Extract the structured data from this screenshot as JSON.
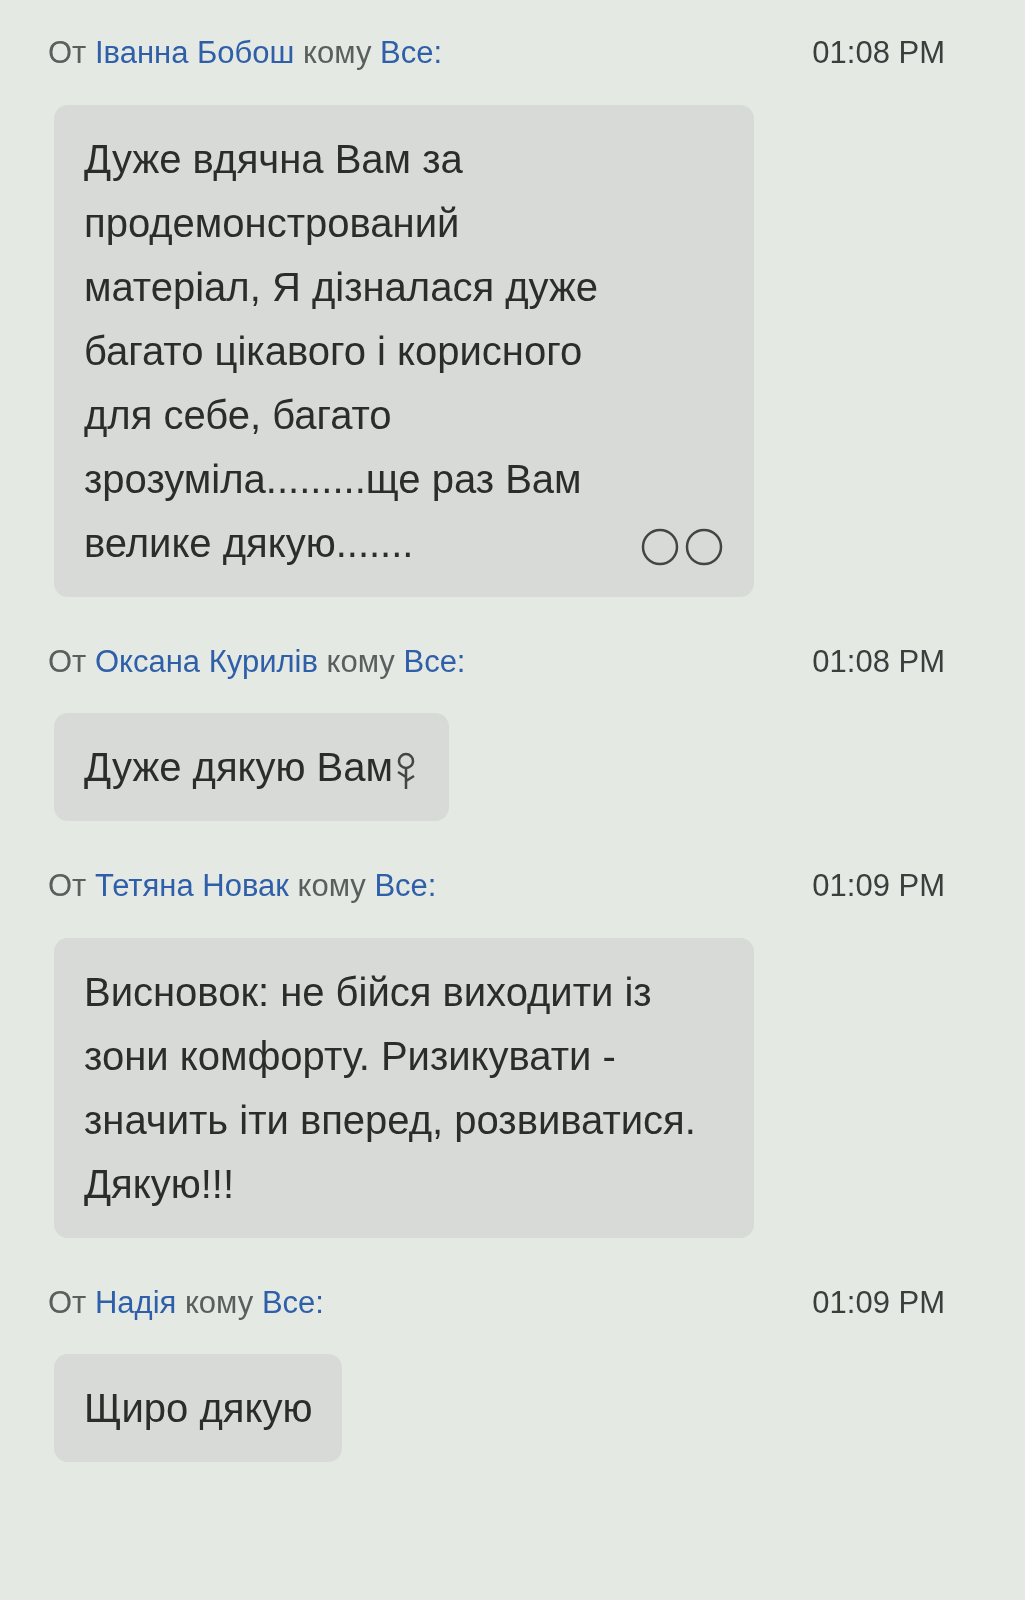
{
  "messages": [
    {
      "from_label": "От",
      "sender": "Іванна Бобош",
      "to_label": "кому",
      "recipient": "Все:",
      "time": "01:08 PM",
      "text": "Дуже вдячна Вам за продемонстрований матеріал, Я дізналася дуже багато цікавого і корисного для себе, багато зрозуміла.........ще раз Вам велике дякую.......",
      "icons": [
        {
          "kind": "face"
        },
        {
          "kind": "face"
        }
      ]
    },
    {
      "from_label": "От",
      "sender": "Оксана Курилів",
      "to_label": "кому",
      "recipient": "Все:",
      "time": "01:08 PM",
      "text": "Дуже дякую Вам",
      "icons": [
        {
          "kind": "flower"
        }
      ]
    },
    {
      "from_label": "От",
      "sender": "Тетяна Новак",
      "to_label": "кому",
      "recipient": "Все:",
      "time": "01:09 PM",
      "text": "Висновок: не бійся виходити із зони комфорту. Ризикувати - значить іти вперед, розвиватися. Дякую!!!"
    },
    {
      "from_label": "От",
      "sender": "Надія",
      "to_label": "кому",
      "recipient": "Все:",
      "time": "01:09 PM",
      "text": "Щиро дякую"
    }
  ]
}
